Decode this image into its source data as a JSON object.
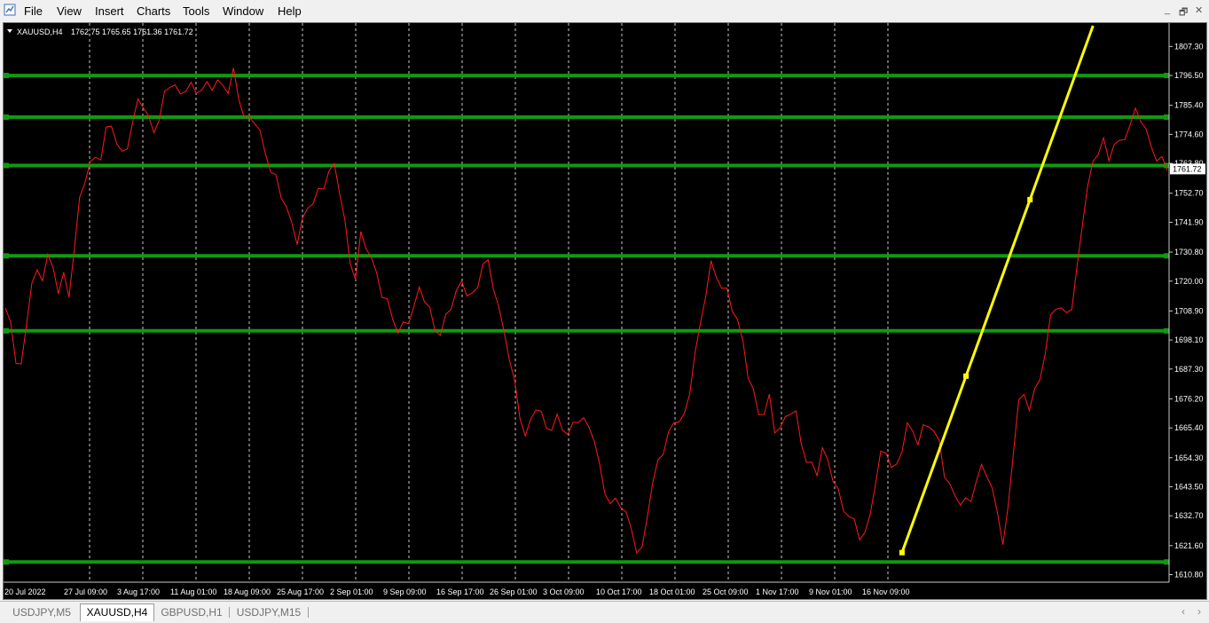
{
  "menu": {
    "items": [
      "File",
      "View",
      "Insert",
      "Charts",
      "Tools",
      "Window",
      "Help"
    ]
  },
  "window_controls": [
    "_",
    "🗗",
    "✕"
  ],
  "chart_header": {
    "symbol": "XAUUSD,H4",
    "ohlc": "1762.75 1765.65 1761.36 1761.72"
  },
  "colors": {
    "background": "#000000",
    "price_line": "#ff1a1a",
    "horizontal_lines": "#119911",
    "trend_line": "#ffff00",
    "grid": "#c8c8c8",
    "axis_text": "#ffffff",
    "current_price_label_bg": "#ffffff"
  },
  "chart_data": {
    "type": "line",
    "symbol": "XAUUSD",
    "timeframe": "H4",
    "current_price": 1761.72,
    "ylim": [
      1608,
      1816
    ],
    "y_ticks": [
      1807.3,
      1796.5,
      1785.4,
      1774.6,
      1763.8,
      1752.7,
      1741.9,
      1730.8,
      1720.0,
      1708.9,
      1698.1,
      1687.3,
      1676.2,
      1665.4,
      1654.3,
      1643.5,
      1632.7,
      1621.6,
      1610.8
    ],
    "x_labels": [
      "20 Jul 2022",
      "27 Jul 09:00",
      "3 Aug 17:00",
      "11 Aug 01:00",
      "18 Aug 09:00",
      "25 Aug 17:00",
      "2 Sep 01:00",
      "9 Sep 09:00",
      "16 Sep 17:00",
      "26 Sep 01:00",
      "3 Oct 09:00",
      "10 Oct 17:00",
      "18 Oct 01:00",
      "25 Oct 09:00",
      "1 Nov 17:00",
      "9 Nov 01:00",
      "16 Nov 09:00"
    ],
    "bar_count": 220,
    "series": [
      {
        "values": [
          1710,
          1704,
          1690,
          1686,
          1712,
          1727,
          1718,
          1732,
          1724,
          1716,
          1722,
          1715,
          1738,
          1752,
          1760,
          1767,
          1765,
          1774,
          1778,
          1772,
          1767,
          1773,
          1780,
          1788,
          1784,
          1776,
          1779,
          1786,
          1793,
          1792,
          1790,
          1794,
          1791,
          1789,
          1792,
          1794,
          1795,
          1792,
          1789,
          1798,
          1790,
          1781,
          1778,
          1780,
          1771,
          1766,
          1760,
          1752,
          1748,
          1741,
          1737,
          1743,
          1747,
          1750,
          1754,
          1760,
          1764,
          1757,
          1743,
          1728,
          1723,
          1738,
          1731,
          1726,
          1720,
          1715,
          1708,
          1700,
          1702,
          1707,
          1711,
          1717,
          1712,
          1706,
          1701,
          1703,
          1709,
          1713,
          1720,
          1718,
          1714,
          1718,
          1728,
          1725,
          1717,
          1704,
          1695,
          1683,
          1672,
          1664,
          1667,
          1674,
          1668,
          1664,
          1670,
          1668,
          1661,
          1664,
          1671,
          1669,
          1665,
          1660,
          1646,
          1642,
          1636,
          1640,
          1632,
          1630,
          1622,
          1619,
          1634,
          1645,
          1654,
          1661,
          1665,
          1670,
          1664,
          1677,
          1693,
          1703,
          1716,
          1726,
          1721,
          1719,
          1714,
          1706,
          1700,
          1689,
          1680,
          1671,
          1670,
          1676,
          1663,
          1667,
          1671,
          1672,
          1663,
          1655,
          1652,
          1649,
          1656,
          1652,
          1647,
          1639,
          1633,
          1630,
          1627,
          1625,
          1632,
          1645,
          1654,
          1658,
          1650,
          1652,
          1663,
          1666,
          1660,
          1665,
          1668,
          1663,
          1658,
          1648,
          1643,
          1640,
          1635,
          1637,
          1644,
          1652,
          1650,
          1640,
          1633,
          1622,
          1640,
          1668,
          1679,
          1672,
          1678,
          1683,
          1692,
          1704,
          1712,
          1710,
          1708,
          1713,
          1730,
          1754,
          1762,
          1769,
          1772,
          1763,
          1774,
          1771,
          1776,
          1779,
          1783,
          1779,
          1772,
          1767,
          1763,
          1761.72
        ]
      }
    ],
    "horizontal_levels": [
      1796.5,
      1781.0,
      1763.0,
      1729.4,
      1701.5,
      1615.5
    ],
    "trend_line": {
      "from": {
        "bar": 169,
        "price": 1619
      },
      "to": {
        "bar": 205,
        "price": 1815
      }
    }
  },
  "tabs": [
    {
      "label": "USDJPY,M5",
      "active": false
    },
    {
      "label": "XAUUSD,H4",
      "active": true
    },
    {
      "label": "GBPUSD,H1",
      "active": false
    },
    {
      "label": "USDJPY,M15",
      "active": false
    }
  ]
}
